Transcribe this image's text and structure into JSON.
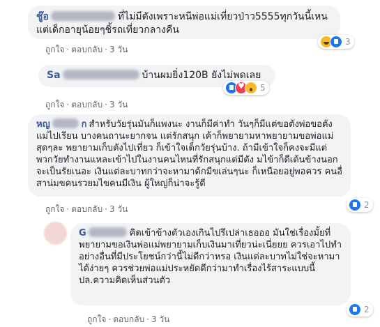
{
  "comments": [
    {
      "author": "ชู๊อ",
      "text": "ที่ไม่มีตังเพราะหนีพ่อแม่เที่ยวป่าว5555ทุกวันนี้เหนแต่เด็กอายุน้อยๆชิ้รถเที่ยวกลางคืน",
      "actions": {
        "like": "ถูกใจ",
        "reply": "ตอบกลับ",
        "time": "3 วัน"
      },
      "reactions": {
        "icons": [
          "haha-icon",
          "like-icon"
        ],
        "count": "3"
      }
    },
    {
      "author": "Sa",
      "text": "บ้านผมยิ่ง120B ยังไม่พดเลย",
      "actions": {
        "like": "ถูกใจ",
        "reply": "ตอบกลับ",
        "time": "3 วัน"
      },
      "reactions": {
        "icons": [
          "like-icon",
          "love-icon",
          "wow-icon"
        ],
        "count": "5"
      }
    },
    {
      "author": "หญ",
      "author_tail": "ก",
      "text": "สำหรับวัยรุ่นมันก็แพงนะ งานก็มีค่าทำ วันๆก็มีแต่ขอตังพ่อขอตังแม่ไปเรียน บางคนถานะยากจน แต่รักสนุก เค้าก็พยายามหาพยายามขอพ่อแม่สุดๆละ พยายามเก็บตังไปเที่ยว ก็เข้าใจเด็กวัยรุ่นบ้าง. ถ้ามีเข้าใจก็คงจะมีแต่พวกวัยทำงานแหละเข้าไปในงานคนไหนที่รักสนุกแต่มีตัง มไข้าก็ดีเต้นข้างนอกจะเป็นรัยเนอะ เงินแต่ละบาทกว่าจะหามาด้กมีขเล่นๆนะ ก็เหนือยอยู่พอควร คนอื่สาน่มขคนรวยมไขคนมีเงิน ผู้ใหญ่ก็น่าจะรู้ดี",
      "actions": {
        "like": "ถูกใจ",
        "reply": "ตอบกลับ",
        "time": "3 วัน"
      },
      "reactions": {
        "icons": [
          "like-icon"
        ],
        "count": "2"
      }
    },
    {
      "author": "G",
      "text": "คิดเข้าข้างตัวเองเกินไปรึเปล่าเธอออ มันใช่เรื่องมั้ยที่พยายามขอเงินพ่อแม่พยายามเก็บเงินมาเที่ยวน่ะเนี่ยยย ควรเอาไปทำอย่างอื่นที่มีประโยชน์กว่านี้ไม่ดีกว่าหรอ เงินแต่ละบาทไม่ใช่จะหามาได้ง่ายๆ ควรช่วยพ่อแม่ประหยัดดีกว่ามาทำเรื่องไร้สาระแบบนี้ ปล.ความคิดเห็นส่วนตัว",
      "actions": {
        "like": "ถูกใจ",
        "reply": "ตอบกลับ",
        "time": "3 วัน"
      },
      "reactions": {
        "icons": [
          "like-icon"
        ],
        "count": "2"
      }
    }
  ]
}
